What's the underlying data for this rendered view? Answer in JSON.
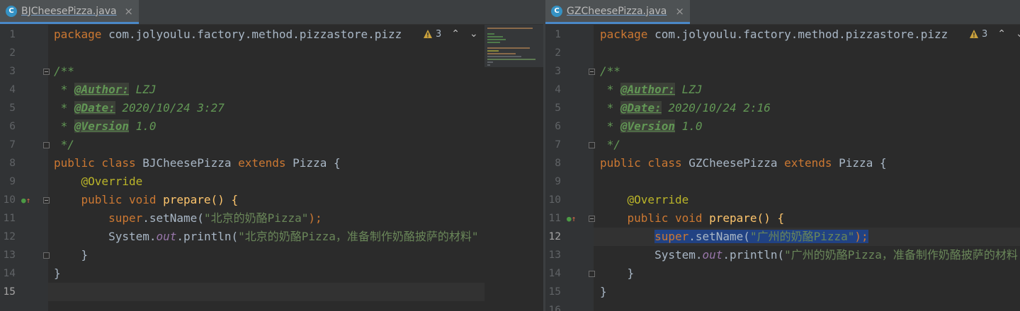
{
  "colors": {
    "background": "#2b2b2b",
    "gutter": "#313335",
    "tab_active": "#4e5254",
    "tab_underline": "#4a88c7",
    "keyword": "#cc7832",
    "string": "#6a8759",
    "annotation": "#bbb529",
    "doc_comment": "#629755",
    "static_field": "#9876aa",
    "selection": "#214283"
  },
  "left": {
    "tab": {
      "icon_letter": "C",
      "filename": "BJCheesePizza.java",
      "close": "×"
    },
    "inspection": {
      "count": "3"
    },
    "lines": [
      {
        "no": "1",
        "text": "package com.jolyoulu.factory.method.pizzastore.pizz"
      },
      {
        "no": "2",
        "text": ""
      },
      {
        "no": "3",
        "text": "/**"
      },
      {
        "no": "4",
        "star": " * ",
        "tag": "@Author:",
        "rest": " LZJ"
      },
      {
        "no": "5",
        "star": " * ",
        "tag": "@Date:",
        "rest": " 2020/10/24 3:27"
      },
      {
        "no": "6",
        "star": " * ",
        "tag": "@Version",
        "rest": " 1.0"
      },
      {
        "no": "7",
        "text": " */"
      },
      {
        "no": "8",
        "kw1": "public class ",
        "name": "BJCheesePizza ",
        "kw2": "extends ",
        "rest": "Pizza {"
      },
      {
        "no": "9",
        "indent": "    ",
        "ann": "@Override"
      },
      {
        "no": "10",
        "indent": "    ",
        "kw1": "public void ",
        "rest": "prepare() {"
      },
      {
        "no": "11",
        "indent": "        ",
        "kw1": "super",
        "mid": ".setName(",
        "str": "\"北京的奶酪Pizza\"",
        "rest": ");"
      },
      {
        "no": "12",
        "indent": "        ",
        "pre": "System.",
        "st": "out",
        "mid": ".println(",
        "str": "\"北京的奶酪Pizza，准备制作奶酪披萨的材料\""
      },
      {
        "no": "13",
        "text": "    }"
      },
      {
        "no": "14",
        "text": "}"
      },
      {
        "no": "15",
        "text": ""
      }
    ]
  },
  "right": {
    "tab": {
      "icon_letter": "C",
      "filename": "GZCheesePizza.java",
      "close": "×"
    },
    "inspection": {
      "count": "3"
    },
    "lines": [
      {
        "no": "1",
        "text": "package com.jolyoulu.factory.method.pizzastore.pizz"
      },
      {
        "no": "2",
        "text": ""
      },
      {
        "no": "3",
        "text": "/**"
      },
      {
        "no": "4",
        "star": " * ",
        "tag": "@Author:",
        "rest": " LZJ"
      },
      {
        "no": "5",
        "star": " * ",
        "tag": "@Date:",
        "rest": " 2020/10/24 2:16"
      },
      {
        "no": "6",
        "star": " * ",
        "tag": "@Version",
        "rest": " 1.0"
      },
      {
        "no": "7",
        "text": " */"
      },
      {
        "no": "8",
        "kw1": "public class ",
        "name": "GZCheesePizza ",
        "kw2": "extends ",
        "rest": "Pizza {"
      },
      {
        "no": "9",
        "text": ""
      },
      {
        "no": "10",
        "indent": "    ",
        "ann": "@Override"
      },
      {
        "no": "11",
        "indent": "    ",
        "kw1": "public void ",
        "rest": "prepare() {"
      },
      {
        "no": "12",
        "indent": "        ",
        "kw1": "super",
        "mid": ".setName(",
        "str": "\"广州的奶酪Pizza\"",
        "rest": ");"
      },
      {
        "no": "13",
        "indent": "        ",
        "pre": "System.",
        "st": "out",
        "mid": ".println(",
        "str": "\"广州的奶酪Pizza，准备制作奶酪披萨的材料"
      },
      {
        "no": "14",
        "text": "    }"
      },
      {
        "no": "15",
        "text": "}"
      },
      {
        "no": "16",
        "text": ""
      }
    ]
  }
}
